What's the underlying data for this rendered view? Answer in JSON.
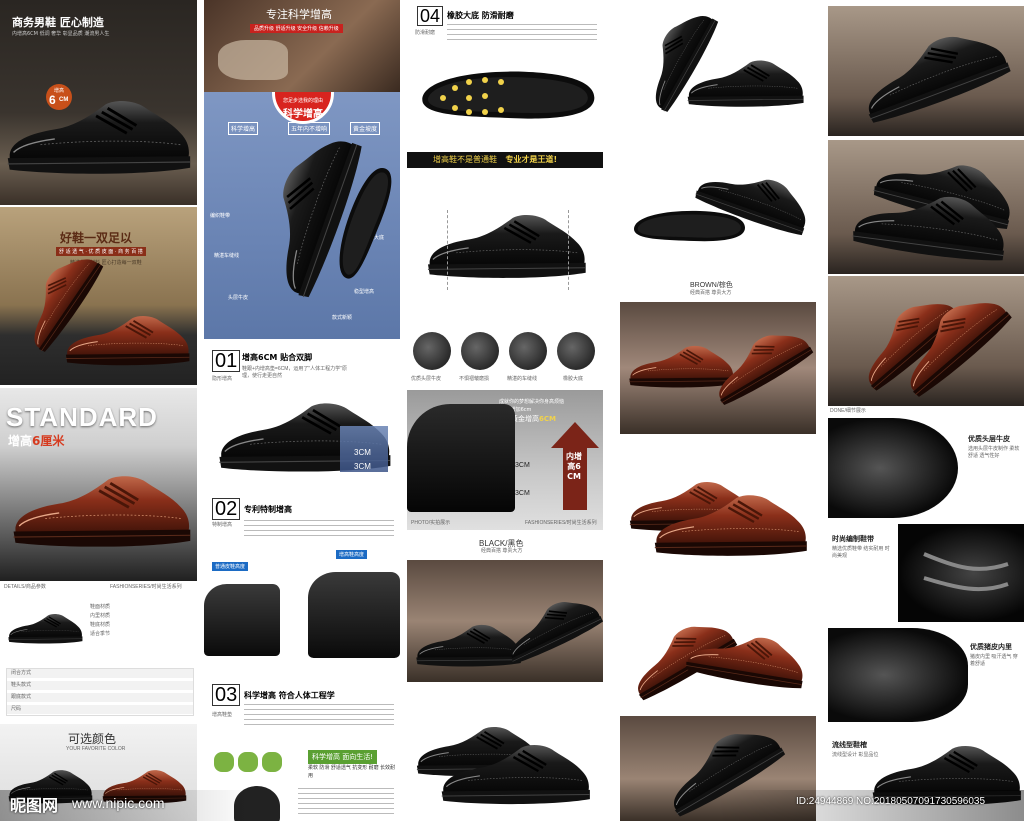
{
  "col1": {
    "p1": {
      "title": "商务男鞋 匠心制造",
      "sub": "内增高6CM 低调 奢华 彰显品质 潮流男人生",
      "badge_num": "6",
      "badge_unit": "CM",
      "badge_top": "增高"
    },
    "p2": {
      "title": "好鞋一双足以",
      "sub": "舒 适 透 气 · 优 质 皮 面 · 商 务 百 搭",
      "desc": "精选优质材料 匠心打造每一双鞋"
    },
    "p3": {
      "title": "STANDARD",
      "sub_prefix": "增高",
      "sub_highlight": "6厘米"
    },
    "p4": {
      "header_left": "DETAILS/商品参数",
      "header_right": "FASHIONSERIES/时尚生活系列",
      "params": [
        "鞋面材质",
        "内里材质",
        "鞋底材质",
        "适合季节",
        "闭合方式",
        "鞋头款式",
        "跟底款式",
        "尺码"
      ]
    },
    "p5": {
      "title": "可选颜色",
      "sub": "YOUR FAVORITE COLOR"
    }
  },
  "col2": {
    "p1": {
      "title": "专注科学增高",
      "ribbon": "品质升级 舒适升级 安全升级 信赖升级",
      "circle_top": "您足步选我的理由",
      "circle_main": "科学增高"
    },
    "p2": {
      "tags": [
        "科学增高",
        "五年内不增响",
        "黄金坡度"
      ],
      "labels_left": [
        "编织鞋带",
        "精湛车缝线",
        "头层牛皮"
      ],
      "labels_right": [
        "橡胶大底",
        "稳型增高",
        "款式新颖"
      ]
    },
    "p3": {
      "num": "01",
      "title": "增高6CM 贴合双脚",
      "icon_label": "隐形增高",
      "desc": "鞋跟+内增高垫=6CM，运用了\"人体工程力学\"原理，使行走更自然",
      "m1": "3CM",
      "m2": "3CM"
    },
    "p4": {
      "num": "02",
      "title": "专利特制增高",
      "icon_label": "特制增高",
      "tag_a": "普通皮鞋高度",
      "tag_b": "增高鞋高度"
    },
    "p5": {
      "num": "03",
      "title": "科学增高 符合人体工程学",
      "icon_label": "增高鞋垫",
      "banner": "科学增高 面向生活!",
      "chips": [
        "柔软",
        "防滑",
        "舒适透气",
        "抗变形",
        "耐磨",
        "长效耐用"
      ]
    }
  },
  "col3": {
    "p1": {
      "num": "04",
      "title": "橡胶大底 防滑耐磨",
      "icon_label": "防滑耐磨"
    },
    "p2": {
      "banner_left": "增高鞋不是普通鞋",
      "banner_right": "专业才是王道!",
      "captions": [
        "优质头层牛皮",
        "不惧褶皱磨损",
        "精湛的车缝线",
        "橡胶大底"
      ]
    },
    "p3": {
      "line1": "成就你的梦想解决你身高烦恼",
      "line2": "完美 增加6cm",
      "gold_prefix": "黄金增高",
      "gold_value": "6CM",
      "m1": "3CM",
      "m2": "3CM",
      "arrow_text": "内增高6CM",
      "footer_left": "PHOTO/实拍展示",
      "footer_right": "FASHIONSERIES/时尚生活系列"
    },
    "p4": {
      "title": "BLACK/黑色",
      "sub": "经典百搭 尊贵大方"
    }
  },
  "col4": {
    "brown_label": "BROWN/棕色",
    "sub": "经典百搭 尊贵大方"
  },
  "col5": {
    "f1": {
      "title": "优质头层牛皮",
      "desc": "选用头层牛皮制作 柔软舒适 透气性好"
    },
    "f2": {
      "title": "时尚编制鞋带",
      "desc": "精选优质鞋带 结实耐用 时尚美观"
    },
    "f3": {
      "title": "优质猪皮内里",
      "desc": "猪皮内里 吸汗透气 穿着舒适"
    },
    "f4": {
      "title": "流线型鞋榷",
      "desc": "流线型设计 彰显品位"
    },
    "detail_label": "DONE/细节展示"
  },
  "watermark": {
    "logo": "昵图网",
    "url": "www.nipic.com",
    "id": "ID:24944869 NO:20180507091730596035"
  },
  "colors": {
    "brown": "#7a2a14",
    "black": "#111111",
    "gold": "#f1d24a",
    "red": "#c8221e",
    "blue_panel": "#6f8ab8"
  }
}
